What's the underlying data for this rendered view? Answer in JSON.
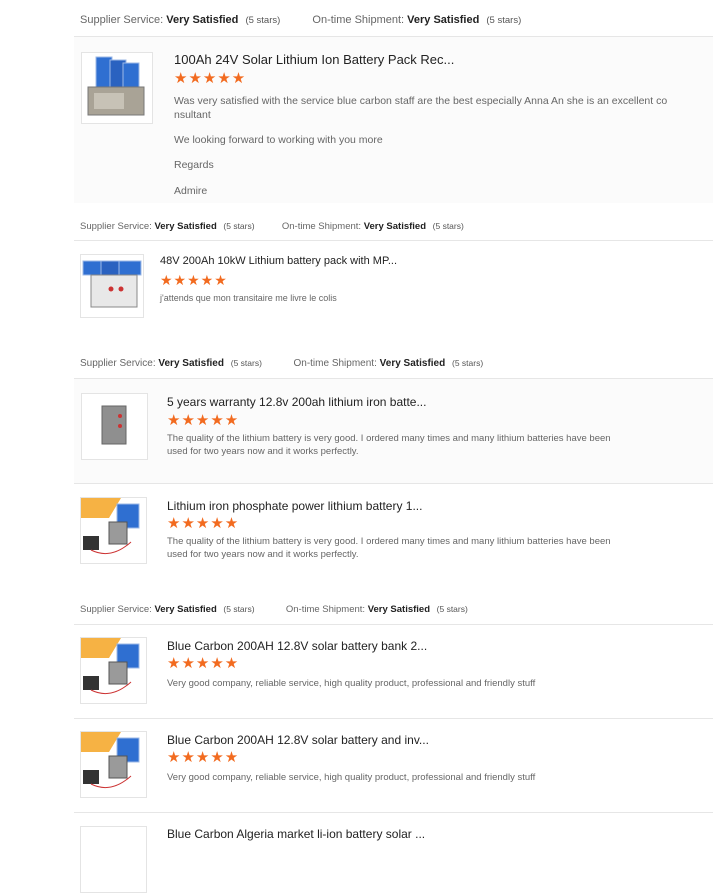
{
  "labels": {
    "supplier_service": "Supplier Service:",
    "ontime_shipment": "On-time Shipment:",
    "rating_word": "Very Satisfied",
    "rating_stars": "(5 stars)"
  },
  "stars": "★★★★★",
  "reviews": [
    {
      "title": "100Ah 24V Solar Lithium Ion Battery Pack Rec...",
      "lines": [
        "Was very satisfied with the service blue carbon staff are the best especially Anna An she is an excellent co",
        "nsultant",
        "We looking forward to working with you more",
        "Regards",
        "Admire"
      ]
    },
    {
      "title": "48V 200Ah 10kW Lithium battery pack with MP...",
      "lines": [
        "j'attends que mon transitaire me livre le colis"
      ]
    },
    {
      "title": "5 years warranty 12.8v 200ah lithium iron batte...",
      "lines": [
        "The quality of the lithium battery is very good. I ordered many times and many lithium batteries have been",
        "used for two years now and it works perfectly."
      ]
    },
    {
      "title": "Lithium iron phosphate power lithium battery 1...",
      "lines": [
        "The quality of the lithium battery is very good. I ordered many times and many lithium batteries have been",
        "used for two years now and it works perfectly."
      ]
    },
    {
      "title": "Blue Carbon 200AH 12.8V solar battery bank 2...",
      "lines": [
        "Very good company, reliable service, high quality product, professional and friendly stuff"
      ]
    },
    {
      "title": "Blue Carbon 200AH 12.8V solar battery and inv...",
      "lines": [
        "Very good company, reliable service, high quality product, professional and friendly stuff"
      ]
    },
    {
      "title": "Blue Carbon Algeria market li-ion battery solar ...",
      "lines": []
    }
  ],
  "colors": {
    "star": "#f26b20",
    "panel_blue": "#2f6fd1",
    "accent_orange": "#f6b244"
  }
}
